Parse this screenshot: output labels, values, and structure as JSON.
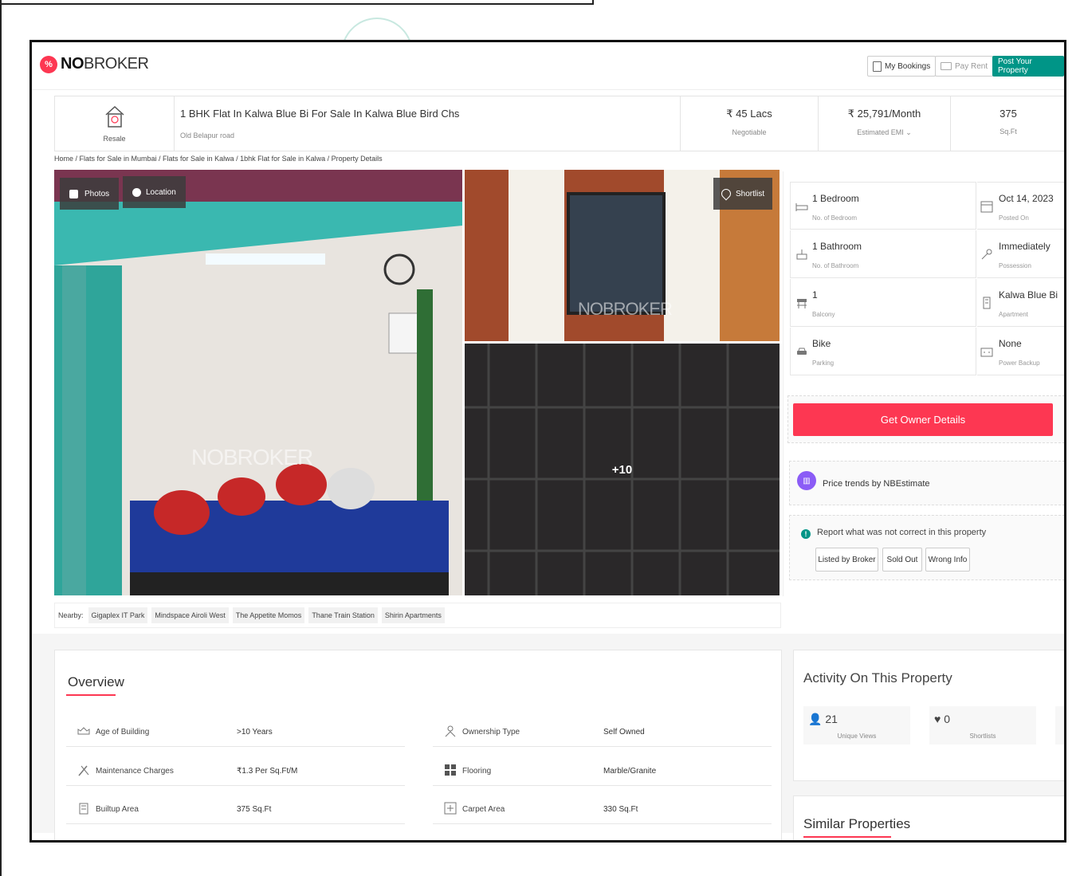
{
  "header": {
    "logo_bold": "NO",
    "logo_rest": "BROKER",
    "my_bookings": "My Bookings",
    "pay_rent": "Pay Rent",
    "post_property": "Post Your Property"
  },
  "titlebar": {
    "type_label": "Resale",
    "title": "1 BHK Flat In Kalwa Blue Bi For Sale In Kalwa Blue Bird Chs",
    "subtitle": "Old Belapur road",
    "price": "₹ 45 Lacs",
    "price_note": "Negotiable",
    "emi": "₹ 25,791/Month",
    "emi_note": "Estimated EMI ⌄",
    "area": "375",
    "area_unit": "Sq.Ft"
  },
  "breadcrumb": "Home / Flats for Sale in Mumbai / Flats for Sale in Kalwa / 1bhk Flat for Sale in Kalwa / Property Details",
  "gallery": {
    "photos_label": "Photos",
    "location_label": "Location",
    "shortlist_label": "Shortlist",
    "watermark_main": "NOBROKER",
    "watermark_tr": "NOBROKER",
    "more_count": "+10"
  },
  "specs": {
    "left": [
      {
        "value": "1 Bedroom",
        "label": "No. of Bedroom",
        "icon": "bed-icon"
      },
      {
        "value": "1 Bathroom",
        "label": "No. of Bathroom",
        "icon": "bath-icon"
      },
      {
        "value": "1",
        "label": "Balcony",
        "icon": "balcony-icon"
      },
      {
        "value": "Bike",
        "label": "Parking",
        "icon": "car-icon"
      }
    ],
    "right": [
      {
        "value": "Oct 14, 2023",
        "label": "Posted On",
        "icon": "calendar-icon"
      },
      {
        "value": "Immediately",
        "label": "Possession",
        "icon": "key-icon"
      },
      {
        "value": "Kalwa Blue Bi",
        "label": "Apartment",
        "icon": "building-icon"
      },
      {
        "value": "None",
        "label": "Power Backup",
        "icon": "battery-icon"
      }
    ]
  },
  "owner_button": "Get Owner Details",
  "price_trends": "Price trends by NBEstimate",
  "report": {
    "text": "Report what was not correct in this property",
    "buttons": [
      "Listed by Broker",
      "Sold Out",
      "Wrong Info"
    ]
  },
  "nearby": {
    "label": "Nearby:",
    "places": [
      "Gigaplex IT Park",
      "Mindspace Airoli West",
      "The Appetite Momos",
      "Thane Train Station",
      "Shirin Apartments"
    ]
  },
  "overview": {
    "title": "Overview",
    "rows": [
      {
        "label": "Age of Building",
        "value": ">10 Years"
      },
      {
        "label": "Ownership Type",
        "value": "Self Owned"
      },
      {
        "label": "Maintenance Charges",
        "value": "₹1.3 Per Sq.Ft/M"
      },
      {
        "label": "Flooring",
        "value": "Marble/Granite"
      },
      {
        "label": "Builtup Area",
        "value": "375 Sq.Ft"
      },
      {
        "label": "Carpet Area",
        "value": "330 Sq.Ft"
      }
    ]
  },
  "activity": {
    "title": "Activity On This Property",
    "views": "21",
    "views_label": "Unique Views",
    "shortlists": "0",
    "shortlists_label": "Shortlists"
  },
  "similar_title": "Similar Properties",
  "colors": {
    "brand_red": "#fd3752",
    "brand_teal": "#009587"
  }
}
